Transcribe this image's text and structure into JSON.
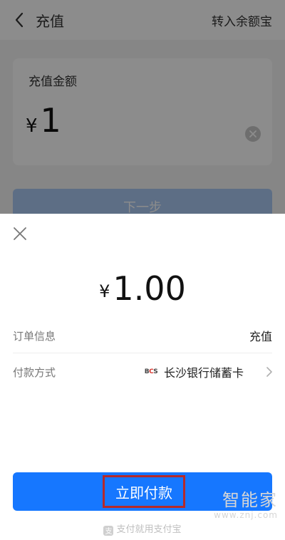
{
  "header": {
    "title": "充值",
    "right_link": "转入余额宝"
  },
  "amount_card": {
    "label": "充值金额",
    "currency": "¥",
    "amount": "1"
  },
  "next_button": {
    "label": "下一步"
  },
  "pay_sheet": {
    "currency": "¥",
    "amount": "1.00",
    "order_info": {
      "label": "订单信息",
      "value": "充值"
    },
    "payment_method": {
      "label": "付款方式",
      "bank_logo": {
        "left": "B",
        "mid": "C",
        "right": "S"
      },
      "value": "长沙银行储蓄卡"
    },
    "pay_button": {
      "label": "立即付款"
    },
    "footer": {
      "icon_char": "支",
      "text": "支付就用支付宝"
    }
  },
  "watermark": {
    "text": "智能家",
    "sub": "www.znj.com"
  },
  "colors": {
    "primary": "#1677ff",
    "next_button_disabled": "#a9c8f3",
    "highlight_border": "#b52a2a"
  },
  "icons": {
    "back": "back-arrow-icon",
    "clear": "clear-icon",
    "close": "close-icon",
    "chevron": "chevron-right-icon"
  }
}
